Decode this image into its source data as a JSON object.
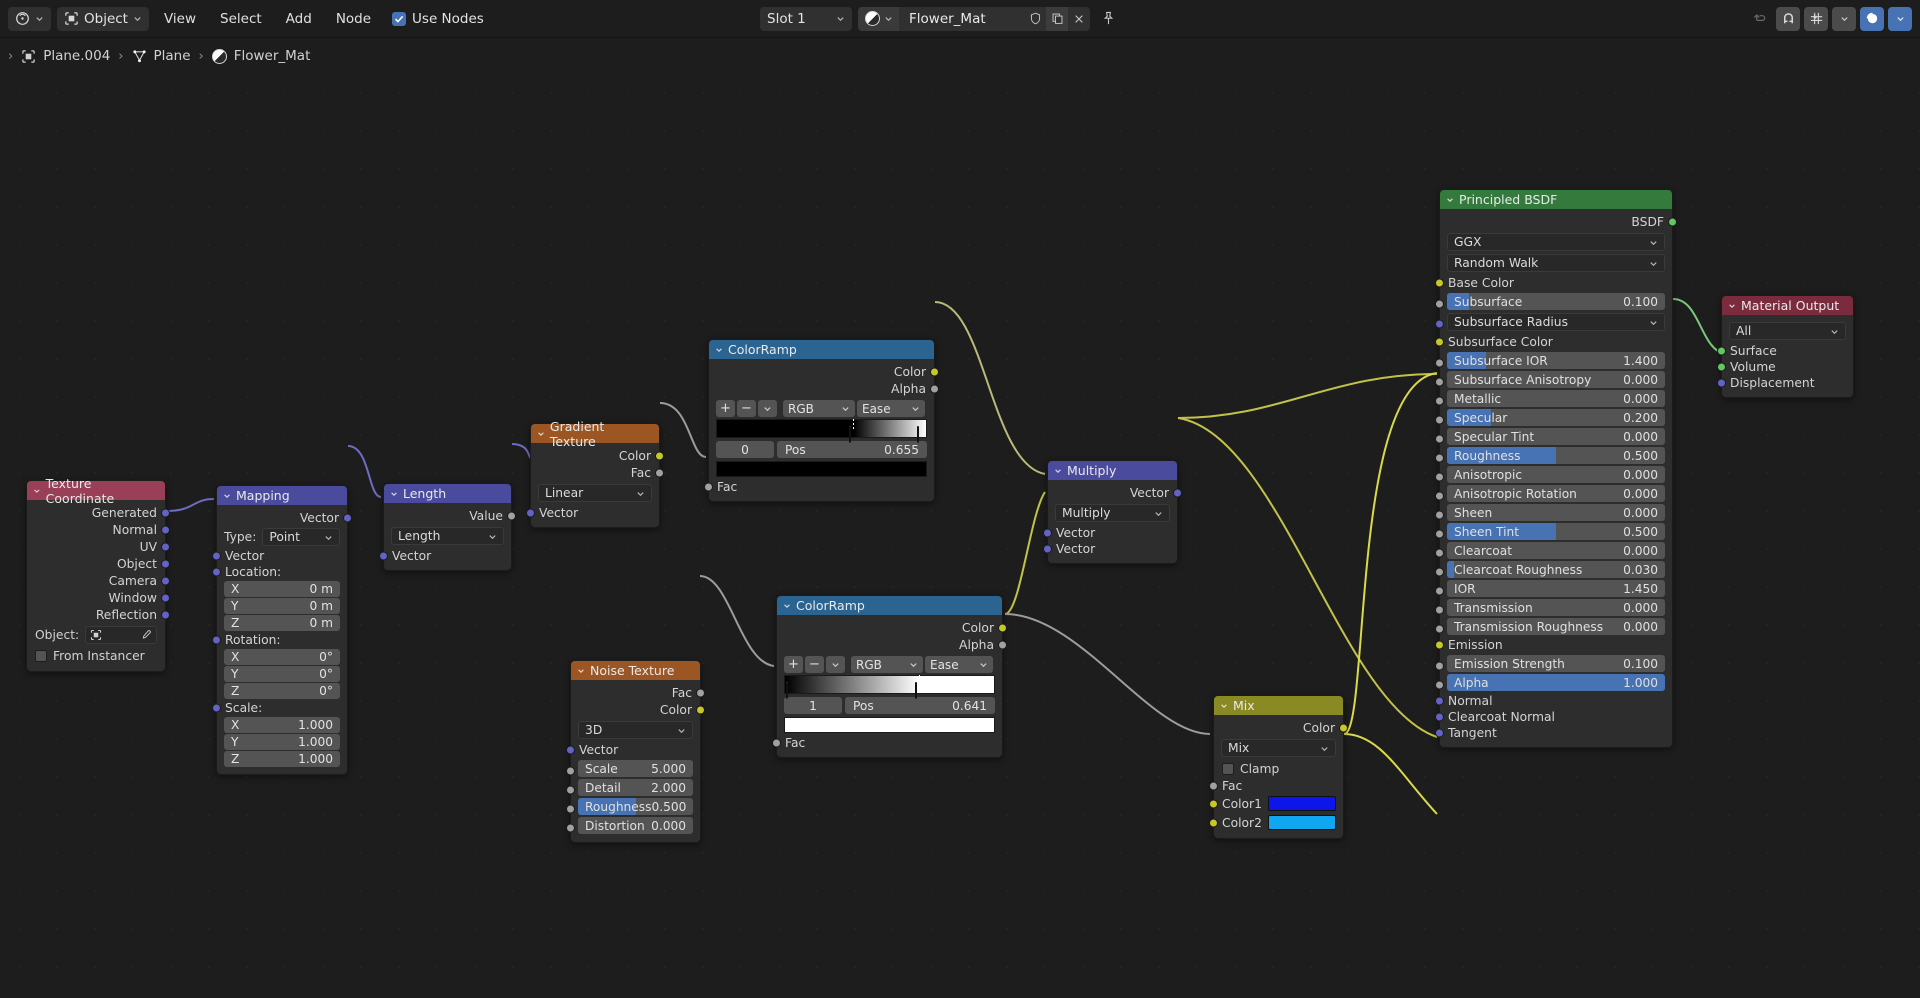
{
  "topbar": {
    "editor_type_icon": "node-editor-icon",
    "shader_type": "Object",
    "menus": [
      "View",
      "Select",
      "Add",
      "Node"
    ],
    "use_nodes_label": "Use Nodes",
    "use_nodes_checked": true,
    "slot_label": "Slot 1",
    "material_name": "Flower_Mat",
    "right_icons": [
      "undo-icon",
      "redo-icon",
      "snap-icon",
      "snap-dropdown-icon",
      "proportional-edit-icon",
      "proportional-dropdown-icon"
    ]
  },
  "breadcrumb": {
    "items": [
      {
        "label": "Plane.004",
        "icon": "object-icon"
      },
      {
        "label": "Plane",
        "icon": "mesh-data-icon"
      },
      {
        "label": "Flower_Mat",
        "icon": "material-icon"
      }
    ]
  },
  "nodes": {
    "texture_coordinate": {
      "title": "Texture Coordinate",
      "header_color": "#9a3f58",
      "outputs": [
        "Generated",
        "Normal",
        "UV",
        "Object",
        "Camera",
        "Window",
        "Reflection"
      ],
      "object_label": "Object:",
      "object_value": "",
      "from_instancer_label": "From Instancer",
      "from_instancer_checked": false
    },
    "mapping": {
      "title": "Mapping",
      "header_color": "#4b4b9e",
      "output": "Vector",
      "type_label": "Type:",
      "type_value": "Point",
      "input_vector": "Vector",
      "location_label": "Location:",
      "location": [
        {
          "axis": "X",
          "value": "0 m"
        },
        {
          "axis": "Y",
          "value": "0 m"
        },
        {
          "axis": "Z",
          "value": "0 m"
        }
      ],
      "rotation_label": "Rotation:",
      "rotation": [
        {
          "axis": "X",
          "value": "0°"
        },
        {
          "axis": "Y",
          "value": "0°"
        },
        {
          "axis": "Z",
          "value": "0°"
        }
      ],
      "scale_label": "Scale:",
      "scale": [
        {
          "axis": "X",
          "value": "1.000"
        },
        {
          "axis": "Y",
          "value": "1.000"
        },
        {
          "axis": "Z",
          "value": "1.000"
        }
      ]
    },
    "length": {
      "title": "Length",
      "header_color": "#4b4b9e",
      "output": "Value",
      "operation": "Length",
      "input": "Vector"
    },
    "gradient_texture": {
      "title": "Gradient Texture",
      "header_color": "#9c5624",
      "outputs": [
        "Color",
        "Fac"
      ],
      "gradient_type": "Linear",
      "input": "Vector"
    },
    "colorramp_1": {
      "title": "ColorRamp",
      "header_color": "#2b6490",
      "outputs": [
        "Color",
        "Alpha"
      ],
      "add_label": "+",
      "remove_label": "−",
      "interpolation_mode": "RGB",
      "interpolation_ease": "Ease",
      "index": "0",
      "pos_label": "Pos",
      "pos_value": "0.655",
      "selected_color": "#000000",
      "stops": [
        {
          "pos": 0.655,
          "color": "#000000"
        },
        {
          "pos": 1.0,
          "color": "#ffffff"
        }
      ],
      "input": "Fac"
    },
    "colorramp_2": {
      "title": "ColorRamp",
      "header_color": "#2b6490",
      "outputs": [
        "Color",
        "Alpha"
      ],
      "add_label": "+",
      "remove_label": "−",
      "interpolation_mode": "RGB",
      "interpolation_ease": "Ease",
      "index": "1",
      "pos_label": "Pos",
      "pos_value": "0.641",
      "selected_color": "#ffffff",
      "stops": [
        {
          "pos": 0.0,
          "color": "#000000"
        },
        {
          "pos": 0.641,
          "color": "#ffffff"
        }
      ],
      "input": "Fac"
    },
    "noise_texture": {
      "title": "Noise Texture",
      "header_color": "#9c5624",
      "outputs": [
        "Fac",
        "Color"
      ],
      "dimensions": "3D",
      "input_vector": "Vector",
      "params": [
        {
          "label": "Scale",
          "value": "5.000",
          "fill": 0
        },
        {
          "label": "Detail",
          "value": "2.000",
          "fill": 0
        },
        {
          "label": "Roughness",
          "value": "0.500",
          "fill": 0.5
        },
        {
          "label": "Distortion",
          "value": "0.000",
          "fill": 0
        }
      ]
    },
    "multiply": {
      "title": "Multiply",
      "header_color": "#4b4b9e",
      "output": "Vector",
      "operation": "Multiply",
      "inputs": [
        "Vector",
        "Vector"
      ]
    },
    "mix": {
      "title": "Mix",
      "header_color": "#8a8a25",
      "output": "Color",
      "blend_mode": "Mix",
      "clamp_label": "Clamp",
      "clamp_checked": false,
      "input_fac": "Fac",
      "color1_label": "Color1",
      "color1_value": "#0d16e8",
      "color2_label": "Color2",
      "color2_value": "#11a7f0"
    },
    "principled_bsdf": {
      "title": "Principled BSDF",
      "header_color": "#347a3c",
      "output": "BSDF",
      "distribution": "GGX",
      "subsurface_method": "Random Walk",
      "rows": [
        {
          "label": "Base Color",
          "type": "socket-label",
          "socket": "color"
        },
        {
          "label": "Subsurface",
          "value": "0.100",
          "fill": 0.1,
          "type": "slider",
          "socket": "grey"
        },
        {
          "label": "Subsurface Radius",
          "type": "dropdown",
          "socket": "vector"
        },
        {
          "label": "Subsurface Color",
          "type": "socket-label",
          "socket": "color"
        },
        {
          "label": "Subsurface IOR",
          "value": "1.400",
          "fill": 0.18,
          "type": "slider",
          "socket": "grey"
        },
        {
          "label": "Subsurface Anisotropy",
          "value": "0.000",
          "fill": 0,
          "type": "slider",
          "socket": "grey"
        },
        {
          "label": "Metallic",
          "value": "0.000",
          "fill": 0,
          "type": "slider",
          "socket": "grey"
        },
        {
          "label": "Specular",
          "value": "0.200",
          "fill": 0.2,
          "type": "slider",
          "socket": "grey"
        },
        {
          "label": "Specular Tint",
          "value": "0.000",
          "fill": 0,
          "type": "slider",
          "socket": "grey"
        },
        {
          "label": "Roughness",
          "value": "0.500",
          "fill": 0.5,
          "type": "slider",
          "socket": "grey"
        },
        {
          "label": "Anisotropic",
          "value": "0.000",
          "fill": 0,
          "type": "slider",
          "socket": "grey"
        },
        {
          "label": "Anisotropic Rotation",
          "value": "0.000",
          "fill": 0,
          "type": "slider",
          "socket": "grey"
        },
        {
          "label": "Sheen",
          "value": "0.000",
          "fill": 0,
          "type": "slider",
          "socket": "grey"
        },
        {
          "label": "Sheen Tint",
          "value": "0.500",
          "fill": 0.5,
          "type": "slider",
          "socket": "grey"
        },
        {
          "label": "Clearcoat",
          "value": "0.000",
          "fill": 0,
          "type": "slider",
          "socket": "grey"
        },
        {
          "label": "Clearcoat Roughness",
          "value": "0.030",
          "fill": 0.03,
          "type": "slider",
          "socket": "grey"
        },
        {
          "label": "IOR",
          "value": "1.450",
          "fill": 0,
          "type": "slider",
          "socket": "grey"
        },
        {
          "label": "Transmission",
          "value": "0.000",
          "fill": 0,
          "type": "slider",
          "socket": "grey"
        },
        {
          "label": "Transmission Roughness",
          "value": "0.000",
          "fill": 0,
          "type": "slider",
          "socket": "grey"
        },
        {
          "label": "Emission",
          "type": "socket-label",
          "socket": "color"
        },
        {
          "label": "Emission Strength",
          "value": "0.100",
          "fill": 0,
          "type": "slider",
          "socket": "grey"
        },
        {
          "label": "Alpha",
          "value": "1.000",
          "fill": 1.0,
          "type": "slider",
          "socket": "grey"
        },
        {
          "label": "Normal",
          "type": "socket-label",
          "socket": "vector"
        },
        {
          "label": "Clearcoat Normal",
          "type": "socket-label",
          "socket": "vector"
        },
        {
          "label": "Tangent",
          "type": "socket-label",
          "socket": "vector"
        }
      ]
    },
    "material_output": {
      "title": "Material Output",
      "header_color": "#7a2b3d",
      "target": "All",
      "inputs": [
        {
          "label": "Surface",
          "socket": "shader"
        },
        {
          "label": "Volume",
          "socket": "shader"
        },
        {
          "label": "Displacement",
          "socket": "vector"
        }
      ]
    }
  }
}
